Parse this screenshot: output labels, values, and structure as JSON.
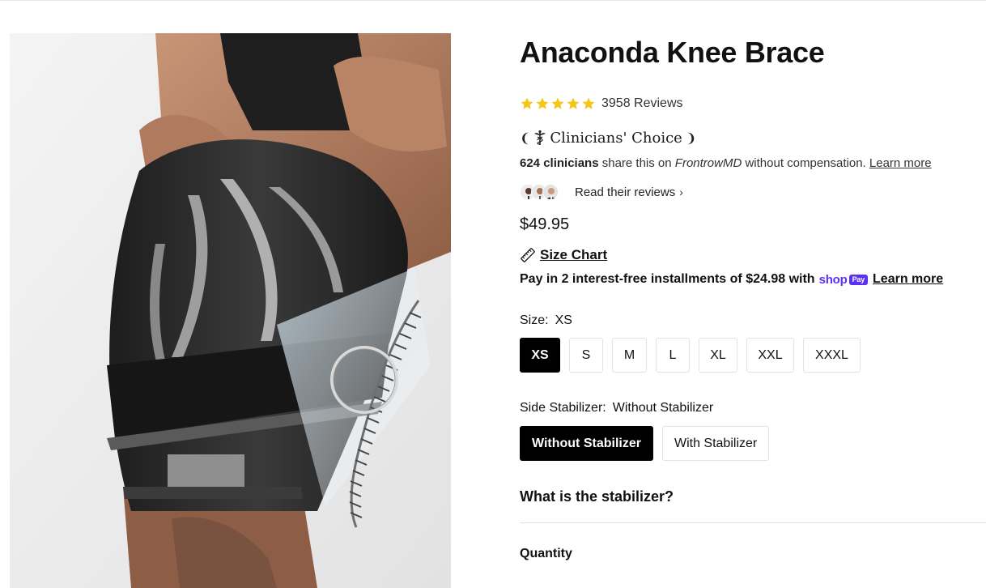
{
  "product": {
    "title": "Anaconda Knee Brace",
    "rating": {
      "stars": 5,
      "reviews_label": "3958 Reviews",
      "star_color": "#f5c518"
    },
    "clinicians_choice": {
      "left_ornament": "❨",
      "label": "Clinicians' Choice",
      "right_ornament": "❩",
      "icon": "caduceus-icon"
    },
    "clinicians_note": {
      "count": "624 clinicians",
      "text_before": " share this on ",
      "platform": "FrontrowMD",
      "text_after": " without compensation. ",
      "link": "Learn more"
    },
    "reviews_link": {
      "label": "Read their reviews",
      "chevron": "›"
    },
    "price": "$49.95",
    "size_chart": {
      "label": "Size Chart",
      "icon": "ruler-icon"
    },
    "installments": {
      "text": "Pay in 2 interest-free installments of $24.98 with",
      "provider_word": "shop",
      "provider_badge": "Pay",
      "link": "Learn more",
      "provider_color": "#5a31f4"
    },
    "size_option": {
      "label": "Size:",
      "selected": "XS",
      "options": [
        "XS",
        "S",
        "M",
        "L",
        "XL",
        "XXL",
        "XXXL"
      ]
    },
    "stabilizer_option": {
      "label": "Side Stabilizer:",
      "selected": "Without Stabilizer",
      "options": [
        "Without Stabilizer",
        "With Stabilizer"
      ]
    },
    "stabilizer_question": "What is the stabilizer?",
    "quantity_label": "Quantity"
  },
  "colors": {
    "accent": "#000000",
    "text": "#111111",
    "border": "#e3e3e3"
  }
}
